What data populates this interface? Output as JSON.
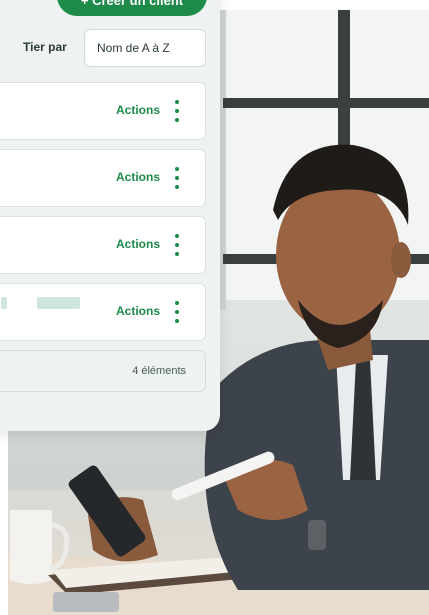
{
  "toolbar": {
    "create_label": "+ Créer un client",
    "sort_label": "Tier par",
    "sort_value": "Nom de A à Z"
  },
  "rows": [
    {
      "actions_label": "Actions"
    },
    {
      "actions_label": "Actions"
    },
    {
      "actions_label": "Actions"
    },
    {
      "actions_label": "Actions"
    }
  ],
  "footer": {
    "count_label": "4 éléments"
  },
  "colors": {
    "accent": "#1d8a49",
    "panel_bg": "#eef3f2",
    "placeholder": "#cfe6dc"
  },
  "icons": [
    "plus-icon",
    "kebab-menu-icon"
  ]
}
